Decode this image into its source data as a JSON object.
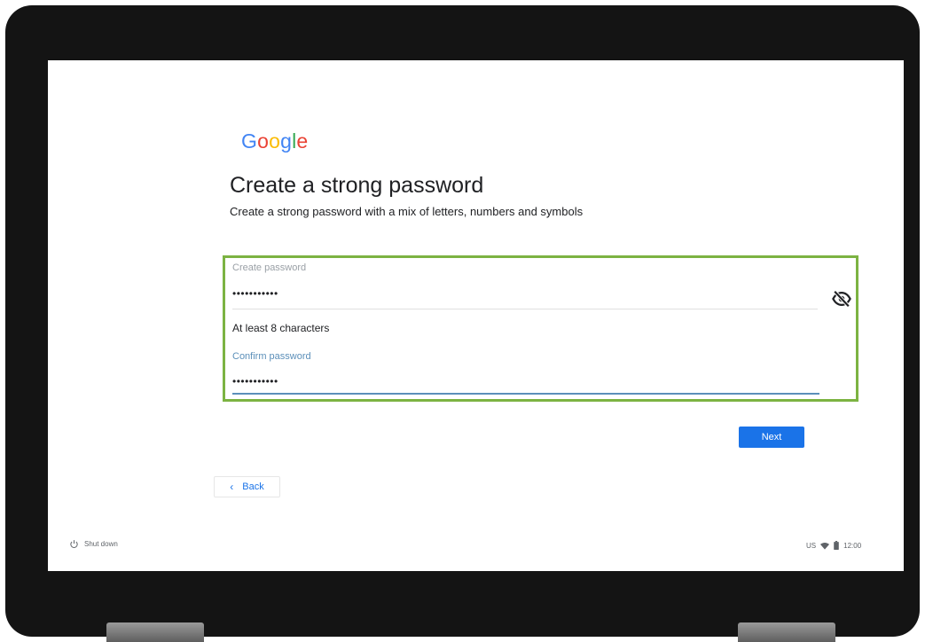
{
  "branding": {
    "logo_letters": [
      "G",
      "o",
      "o",
      "g",
      "l",
      "e"
    ],
    "logo_colors": [
      "#4285F4",
      "#EA4335",
      "#FBBC05",
      "#4285F4",
      "#34A853",
      "#EA4335"
    ]
  },
  "page": {
    "title": "Create a strong password",
    "subtitle": "Create a strong password with a mix of letters, numbers and symbols"
  },
  "form": {
    "create_password": {
      "label": "Create password",
      "value": "•••••••••••",
      "helper": "At least 8 characters",
      "visibility_icon": "eye-off-icon"
    },
    "confirm_password": {
      "label": "Confirm password",
      "value": "•••••••••••"
    },
    "highlight_color": "#7cb342",
    "focus_color": "#5b8fb9"
  },
  "actions": {
    "next_label": "Next",
    "back_label": "Back",
    "back_icon": "chevron-left-icon",
    "primary_color": "#1a73e8"
  },
  "footer": {
    "shutdown_label": "Shut down",
    "shutdown_icon": "power-icon",
    "status": {
      "keyboard_layout": "US",
      "wifi_icon": "wifi-icon",
      "battery_icon": "battery-icon",
      "time": "12:00"
    }
  }
}
